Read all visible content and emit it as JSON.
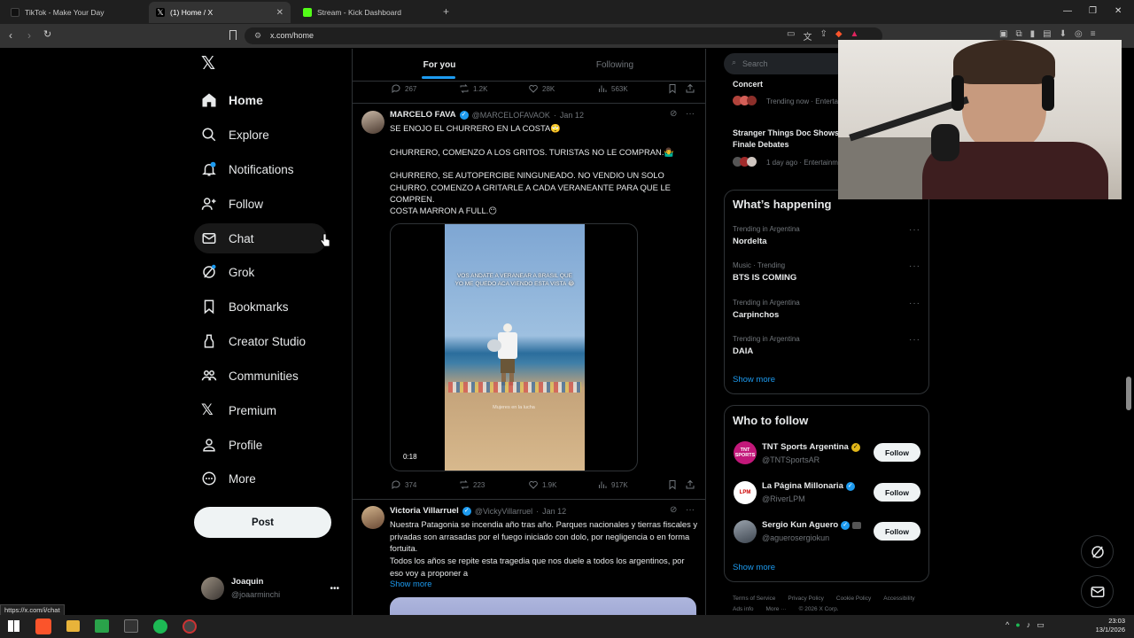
{
  "browser": {
    "tabs": [
      {
        "title": "TikTok - Make Your Day",
        "active": false
      },
      {
        "title": "(1) Home / X",
        "active": true
      },
      {
        "title": "Stream - Kick Dashboard",
        "active": false
      }
    ],
    "url": "x.com/home",
    "status_url": "https://x.com/i/chat"
  },
  "nav": {
    "items": [
      {
        "label": "Home",
        "icon": "home-icon"
      },
      {
        "label": "Explore",
        "icon": "search-icon"
      },
      {
        "label": "Notifications",
        "icon": "bell-icon"
      },
      {
        "label": "Follow",
        "icon": "person-plus-icon"
      },
      {
        "label": "Chat",
        "icon": "mail-icon"
      },
      {
        "label": "Grok",
        "icon": "grok-icon"
      },
      {
        "label": "Bookmarks",
        "icon": "bookmark-icon"
      },
      {
        "label": "Creator Studio",
        "icon": "creator-studio-icon"
      },
      {
        "label": "Communities",
        "icon": "communities-icon"
      },
      {
        "label": "Premium",
        "icon": "x-logo-icon"
      },
      {
        "label": "Profile",
        "icon": "profile-icon"
      },
      {
        "label": "More",
        "icon": "more-circle-icon"
      }
    ],
    "post_label": "Post",
    "user": {
      "name": "Joaquin",
      "handle": "@joaarminchi"
    }
  },
  "timeline": {
    "tabs": [
      "For you",
      "Following"
    ],
    "top_actions": {
      "replies": "267",
      "reposts": "1.2K",
      "likes": "28K",
      "views": "563K"
    },
    "tweets": [
      {
        "author": "MARCELO FAVA",
        "handle": "@MARCELOFAVAOK",
        "date": "Jan 12",
        "lines": [
          "SE ENOJO EL CHURRERO EN LA COSTA🙄",
          "CHURRERO, COMENZO A LOS GRITOS. TURISTAS NO LE COMPRAN.🤷‍♂️",
          "CHURRERO, SE AUTOPERCIBE NINGUNEADO. NO VENDIO UN SOLO CHURRO. COMENZO A GRITARLE A CADA VERANEANTE PARA QUE LE COMPREN.",
          "COSTA MARRON A FULL.😶"
        ],
        "video": {
          "duration": "0:18",
          "caption": "VOS ANDATE A VERANEAR A BRASIL QUE YO ME QUEDO ACA VIENDO ESTA VISTA 😂",
          "watermark": "Mujeres en la lucha"
        },
        "actions": {
          "replies": "374",
          "reposts": "223",
          "likes": "1.9K",
          "views": "917K"
        }
      },
      {
        "author": "Victoria Villarruel",
        "handle": "@VickyVillarruel",
        "date": "Jan 12",
        "lines": [
          "Nuestra Patagonia se incendia año tras año. Parques nacionales y tierras fiscales y privadas son arrasadas por el fuego iniciado con dolo, por negligencia o en forma fortuita.",
          "Todos los años se repite esta tragedia que nos duele a todos los argentinos, por eso voy a proponer a"
        ],
        "show_more": "Show more"
      }
    ]
  },
  "sidebar": {
    "search_placeholder": "Search",
    "top_trends": [
      {
        "name": "Concert",
        "meta": "Trending now · Entertainment"
      },
      {
        "name": "Stranger Things Doc Shows Finale Debates",
        "meta": "1 day ago · Entertainment"
      }
    ],
    "whats_happening": {
      "title": "What’s happening",
      "items": [
        {
          "meta": "Trending in Argentina",
          "name": "Nordelta"
        },
        {
          "meta": "Music · Trending",
          "name": "BTS IS COMING"
        },
        {
          "meta": "Trending in Argentina",
          "name": "Carpinchos"
        },
        {
          "meta": "Trending in Argentina",
          "name": "DAIA"
        }
      ],
      "show_more": "Show more"
    },
    "who_to_follow": {
      "title": "Who to follow",
      "accounts": [
        {
          "name": "TNT Sports Argentina",
          "handle": "@TNTSportsAR",
          "button": "Follow",
          "avatar_text": "TNT SPORTS",
          "avatar_color": "#c2187a"
        },
        {
          "name": "La Página Millonaria",
          "handle": "@RiverLPM",
          "button": "Follow",
          "avatar_text": "LPM",
          "avatar_color": "#ffffff"
        },
        {
          "name": "Sergio Kun Aguero",
          "handle": "@aguerosergiokun",
          "button": "Follow",
          "avatar_text": "",
          "avatar_color": "#6a7380"
        }
      ],
      "show_more": "Show more"
    },
    "footer": [
      "Terms of Service",
      "Privacy Policy",
      "Cookie Policy",
      "Accessibility",
      "Ads info",
      "More ···",
      "© 2026 X Corp."
    ]
  },
  "taskbar": {
    "time": "23:03",
    "date": "13/1/2026"
  },
  "colors": {
    "accent": "#1d9bf0",
    "background": "#000000",
    "border": "#2f3336"
  }
}
